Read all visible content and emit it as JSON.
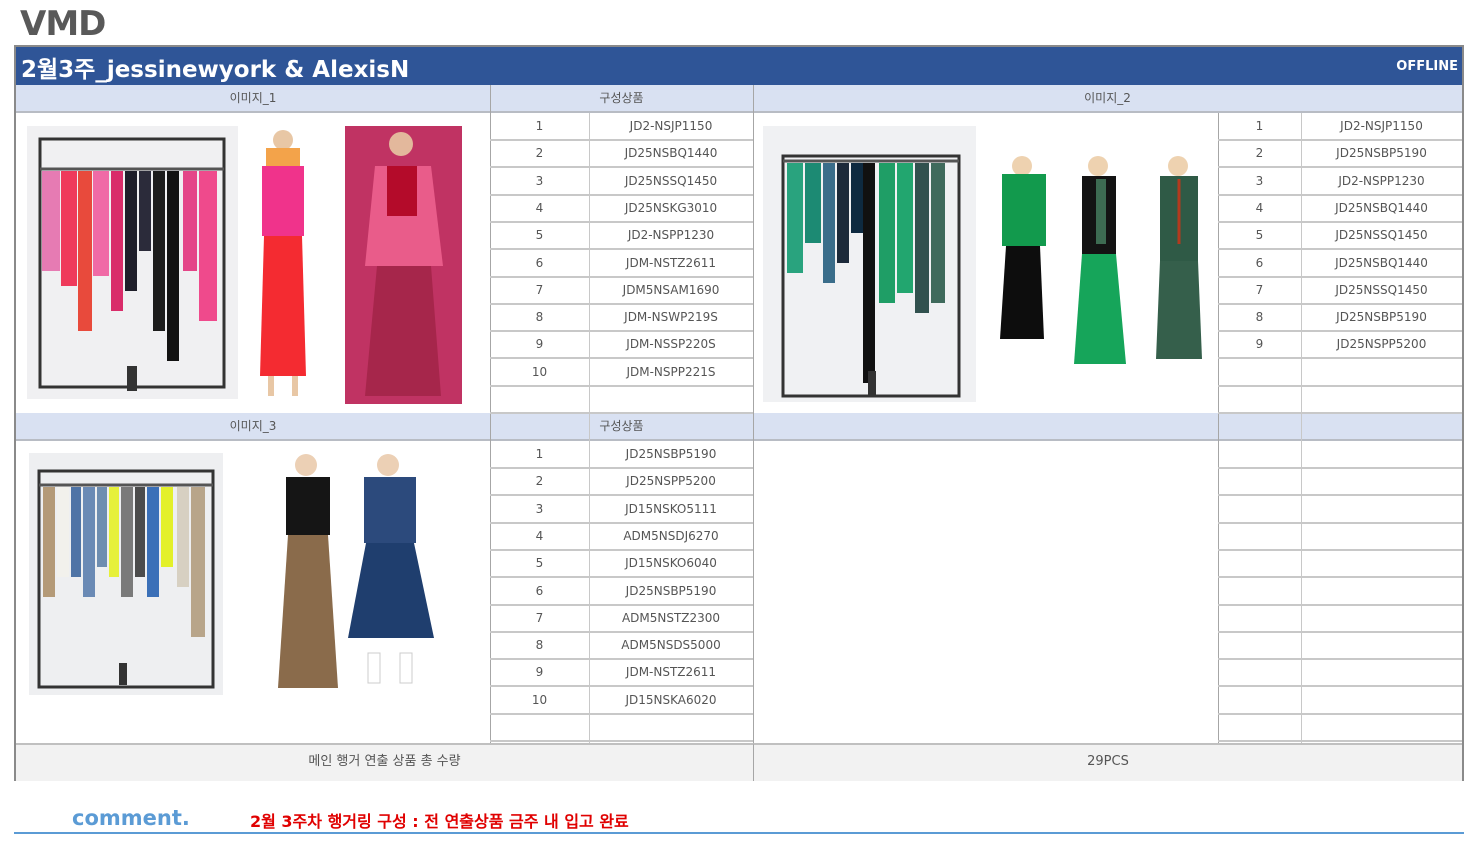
{
  "logo": "VMD",
  "title": "2월3주_jessinewyork & AlexisN",
  "channel": "OFFLINE",
  "headers": {
    "image1": "이미지_1",
    "products1": "구성상품",
    "image2": "이미지_2",
    "image3": "이미지_3",
    "products3": "구성상품"
  },
  "set1": [
    {
      "no": "1",
      "code": "JD2-NSJP1150"
    },
    {
      "no": "2",
      "code": "JD25NSBQ1440"
    },
    {
      "no": "3",
      "code": "JD25NSSQ1450"
    },
    {
      "no": "4",
      "code": "JD25NSKG3010"
    },
    {
      "no": "5",
      "code": "JD2-NSPP1230"
    },
    {
      "no": "6",
      "code": "JDM-NSTZ2611"
    },
    {
      "no": "7",
      "code": "JDM5NSAM1690"
    },
    {
      "no": "8",
      "code": "JDM-NSWP219S"
    },
    {
      "no": "9",
      "code": "JDM-NSSP220S"
    },
    {
      "no": "10",
      "code": "JDM-NSPP221S"
    },
    {
      "no": "",
      "code": ""
    }
  ],
  "set2": [
    {
      "no": "1",
      "code": "JD2-NSJP1150"
    },
    {
      "no": "2",
      "code": "JD25NSBP5190"
    },
    {
      "no": "3",
      "code": "JD2-NSPP1230"
    },
    {
      "no": "4",
      "code": "JD25NSBQ1440"
    },
    {
      "no": "5",
      "code": "JD25NSSQ1450"
    },
    {
      "no": "6",
      "code": "JD25NSBQ1440"
    },
    {
      "no": "7",
      "code": "JD25NSSQ1450"
    },
    {
      "no": "8",
      "code": "JD25NSBP5190"
    },
    {
      "no": "9",
      "code": "JD25NSPP5200"
    },
    {
      "no": "",
      "code": ""
    },
    {
      "no": "",
      "code": ""
    }
  ],
  "set3": [
    {
      "no": "1",
      "code": "JD25NSBP5190"
    },
    {
      "no": "2",
      "code": "JD25NSPP5200"
    },
    {
      "no": "3",
      "code": "JD15NSKO5111"
    },
    {
      "no": "4",
      "code": "ADM5NSDJ6270"
    },
    {
      "no": "5",
      "code": "JD15NSKO6040"
    },
    {
      "no": "6",
      "code": "JD25NSBP5190"
    },
    {
      "no": "7",
      "code": "ADM5NSTZ2300"
    },
    {
      "no": "8",
      "code": "ADM5NSDS5000"
    },
    {
      "no": "9",
      "code": "JDM-NSTZ2611"
    },
    {
      "no": "10",
      "code": "JD15NSKA6020"
    },
    {
      "no": "",
      "code": ""
    }
  ],
  "footer": {
    "label": "메인 행거 연출 상품 총 수량",
    "total": "29PCS"
  },
  "comment": {
    "label": "comment.",
    "text": "2월 3주차 행거링 구성 : 전 연출상품 금주 내 입고 완료"
  },
  "colors": {
    "title_bg": "#2f5597",
    "header_bg": "#d9e1f2",
    "comment_blue": "#5b9bd5",
    "note_red": "#e00000"
  }
}
